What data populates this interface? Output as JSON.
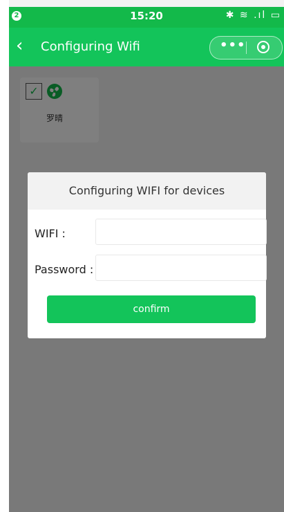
{
  "status_bar": {
    "badge": "2",
    "time": "15:20",
    "icons": "✱ ≋ .ıl ▭"
  },
  "nav": {
    "back_symbol": "‹",
    "title": "Configuring Wifi",
    "more_symbol": "•••"
  },
  "device": {
    "name": "罗晴",
    "checked": true,
    "icon": "fan-icon"
  },
  "dialog": {
    "title": "Configuring WIFI for devices",
    "wifi_label": "WIFI :",
    "wifi_value": "",
    "password_label": "Password :",
    "password_value": "",
    "confirm_label": "confirm"
  },
  "colors": {
    "accent": "#13c45a",
    "status_bar": "#13b94a",
    "overlay": "rgba(0,0,0,0.5)"
  }
}
